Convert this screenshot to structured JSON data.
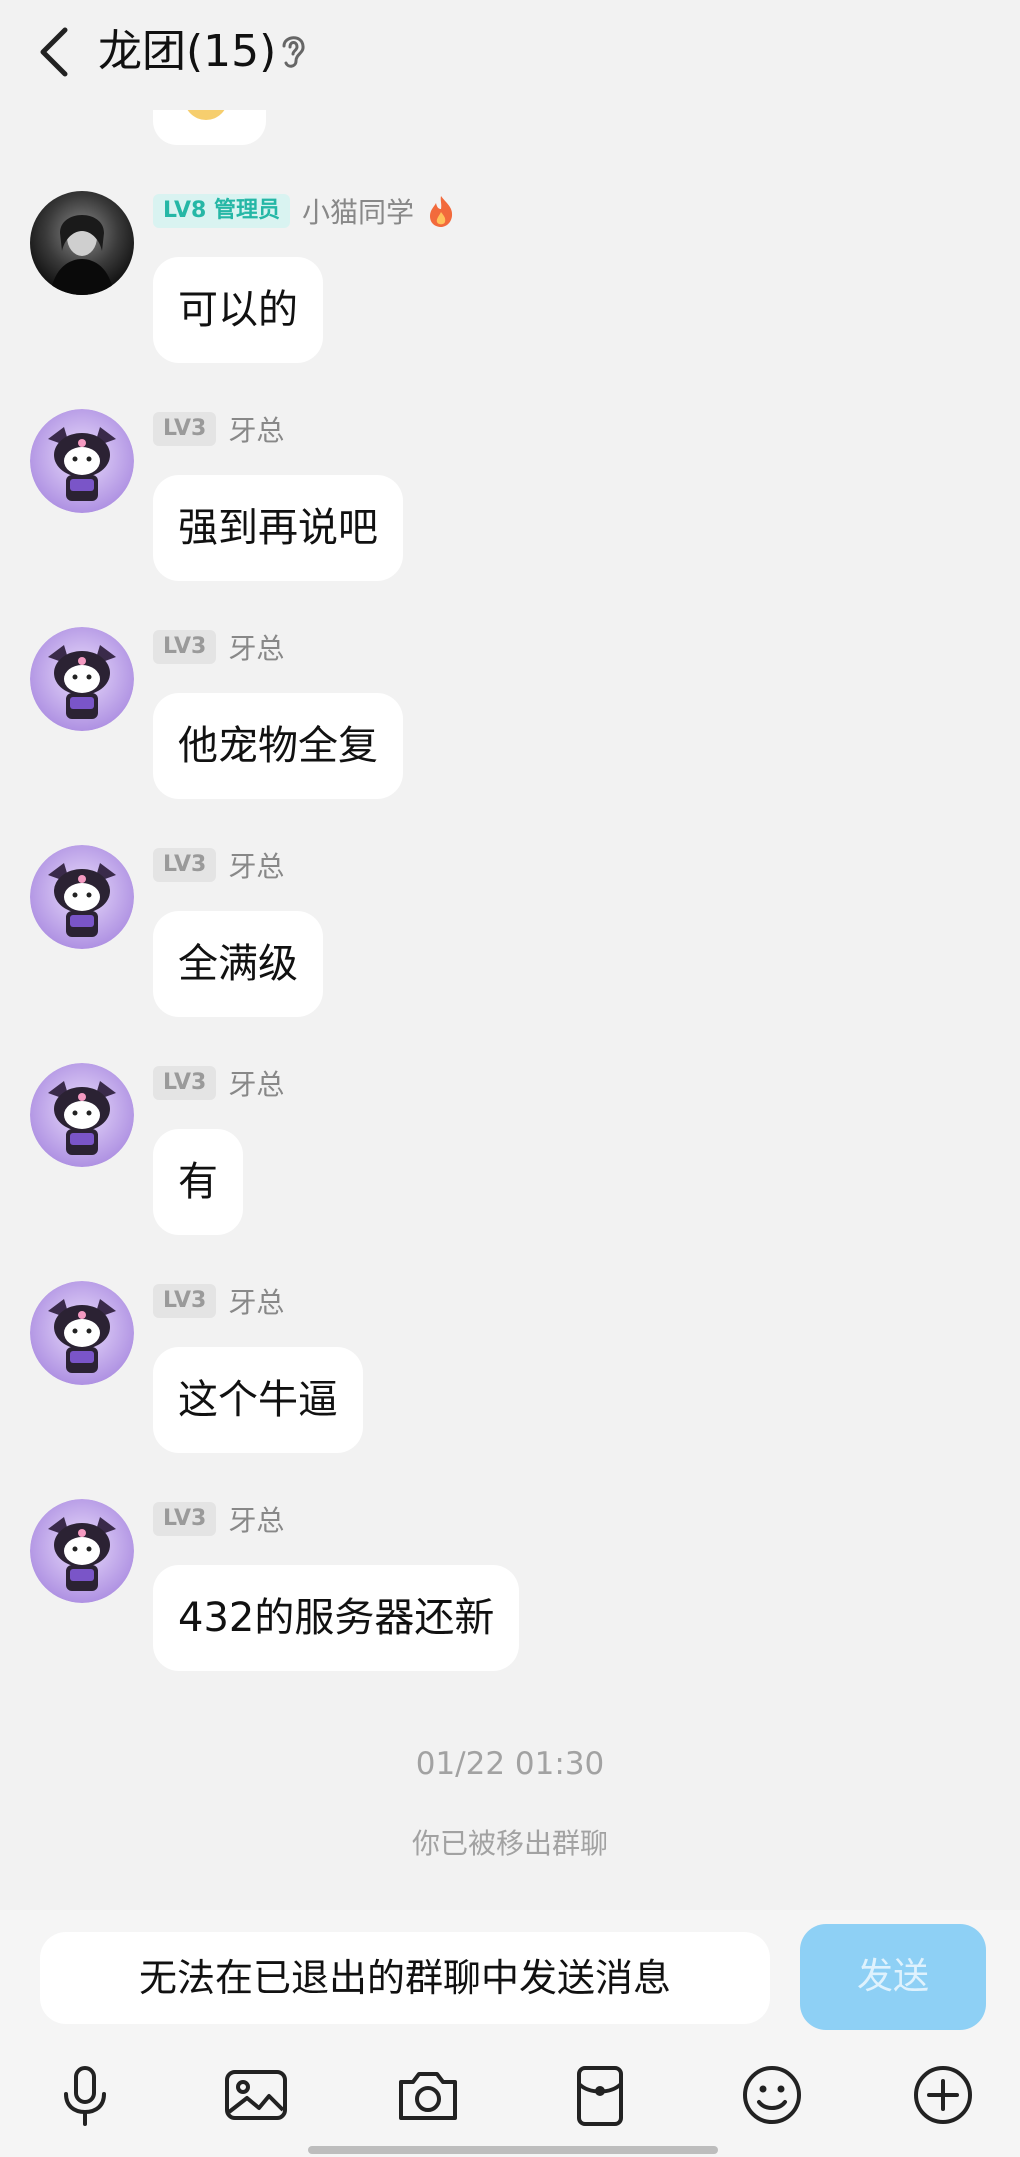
{
  "header": {
    "back_icon": "chevron-left-icon",
    "title": "龙团(15)",
    "ear_icon": "ear-icon"
  },
  "messages": [
    {
      "avatar": "dark-portrait-avatar",
      "badge": "LV8 管理员",
      "badge_type": "admin",
      "nick": "小猫同学",
      "flair_icon": "flame-icon",
      "text": "可以的"
    },
    {
      "avatar": "kuromi-avatar",
      "badge": "LV3",
      "badge_type": "level",
      "nick": "牙总",
      "text": "强到再说吧"
    },
    {
      "avatar": "kuromi-avatar",
      "badge": "LV3",
      "badge_type": "level",
      "nick": "牙总",
      "text": "他宠物全复"
    },
    {
      "avatar": "kuromi-avatar",
      "badge": "LV3",
      "badge_type": "level",
      "nick": "牙总",
      "text": "全满级"
    },
    {
      "avatar": "kuromi-avatar",
      "badge": "LV3",
      "badge_type": "level",
      "nick": "牙总",
      "text": "有"
    },
    {
      "avatar": "kuromi-avatar",
      "badge": "LV3",
      "badge_type": "level",
      "nick": "牙总",
      "text": "这个牛逼"
    },
    {
      "avatar": "kuromi-avatar",
      "badge": "LV3",
      "badge_type": "level",
      "nick": "牙总",
      "text": "432的服务器还新"
    }
  ],
  "timestamp": "01/22 01:30",
  "system_notice": "你已被移出群聊",
  "input": {
    "placeholder": "无法在已退出的群聊中发送消息",
    "send_label": "发送"
  },
  "toolbar": [
    "microphone-icon",
    "image-icon",
    "camera-icon",
    "red-packet-icon",
    "emoji-icon",
    "plus-icon"
  ],
  "colors": {
    "background": "#f2f2f2",
    "bubble": "#ffffff",
    "send_button": "#8ed0f5",
    "admin_badge_text": "#25b7a6",
    "admin_badge_bg": "#d9f3f1",
    "level_badge_text": "#9a9a9a",
    "avatar_purple": "#b89ae6"
  }
}
